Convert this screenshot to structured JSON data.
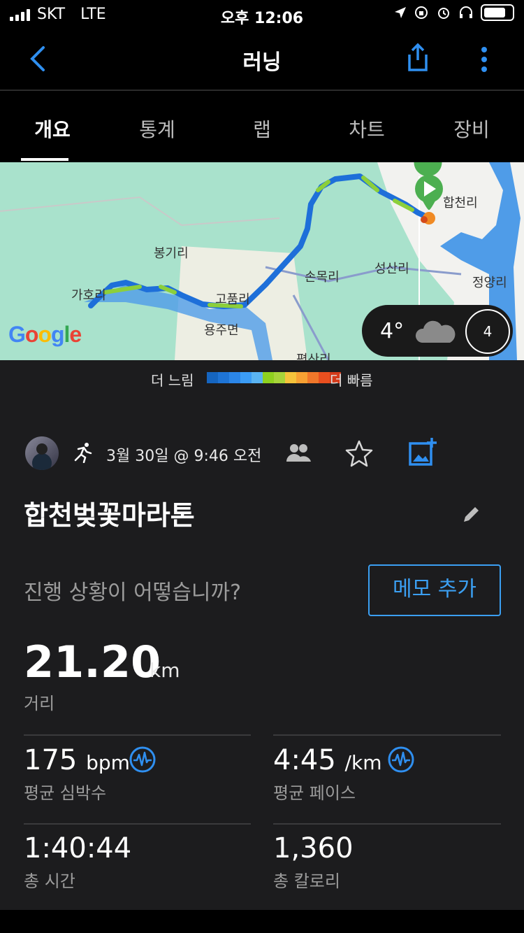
{
  "status": {
    "carrier": "SKT",
    "network": "LTE",
    "time": "오후 12:06"
  },
  "nav": {
    "title": "러닝"
  },
  "tabs": [
    "개요",
    "통계",
    "랩",
    "차트",
    "장비"
  ],
  "map": {
    "places": [
      "합천리",
      "봉기리",
      "성산리",
      "손목리",
      "정양리",
      "가호리",
      "고품리",
      "용주면",
      "평산리"
    ],
    "provider": "Google",
    "weather": {
      "temp": "4°",
      "uv": "4"
    },
    "colors": {
      "route_slow": "#1e6fd9",
      "route_fast": "#8ccf3b",
      "start_marker": "#4caf50"
    }
  },
  "legend": {
    "slow": "더 느림",
    "fast": "더 빠름",
    "colors": [
      "#1565c0",
      "#1e74d6",
      "#2b86e8",
      "#3b9cf5",
      "#5ab4f2",
      "#8ed11f",
      "#a7d43a",
      "#f5c33b",
      "#f7a133",
      "#f0772a",
      "#e84f1f",
      "#d43a1a"
    ]
  },
  "activity": {
    "date": "3월 30일 @ 9:46 오전",
    "title": "합천벚꽃마라톤",
    "prompt": "진행 상황이 어떻습니까?",
    "memo_button": "메모 추가"
  },
  "stats": {
    "distance": {
      "value": "21.20",
      "unit": "km",
      "label": "거리"
    },
    "heart_rate": {
      "value": "175",
      "unit": "bpm",
      "label": "평균 심박수"
    },
    "pace": {
      "value": "4:45",
      "unit": "/km",
      "label": "평균 페이스"
    },
    "time": {
      "value": "1:40:44",
      "label": "총 시간"
    },
    "calories": {
      "value": "1,360",
      "label": "총 칼로리"
    }
  },
  "accent": "#3b9ff2"
}
